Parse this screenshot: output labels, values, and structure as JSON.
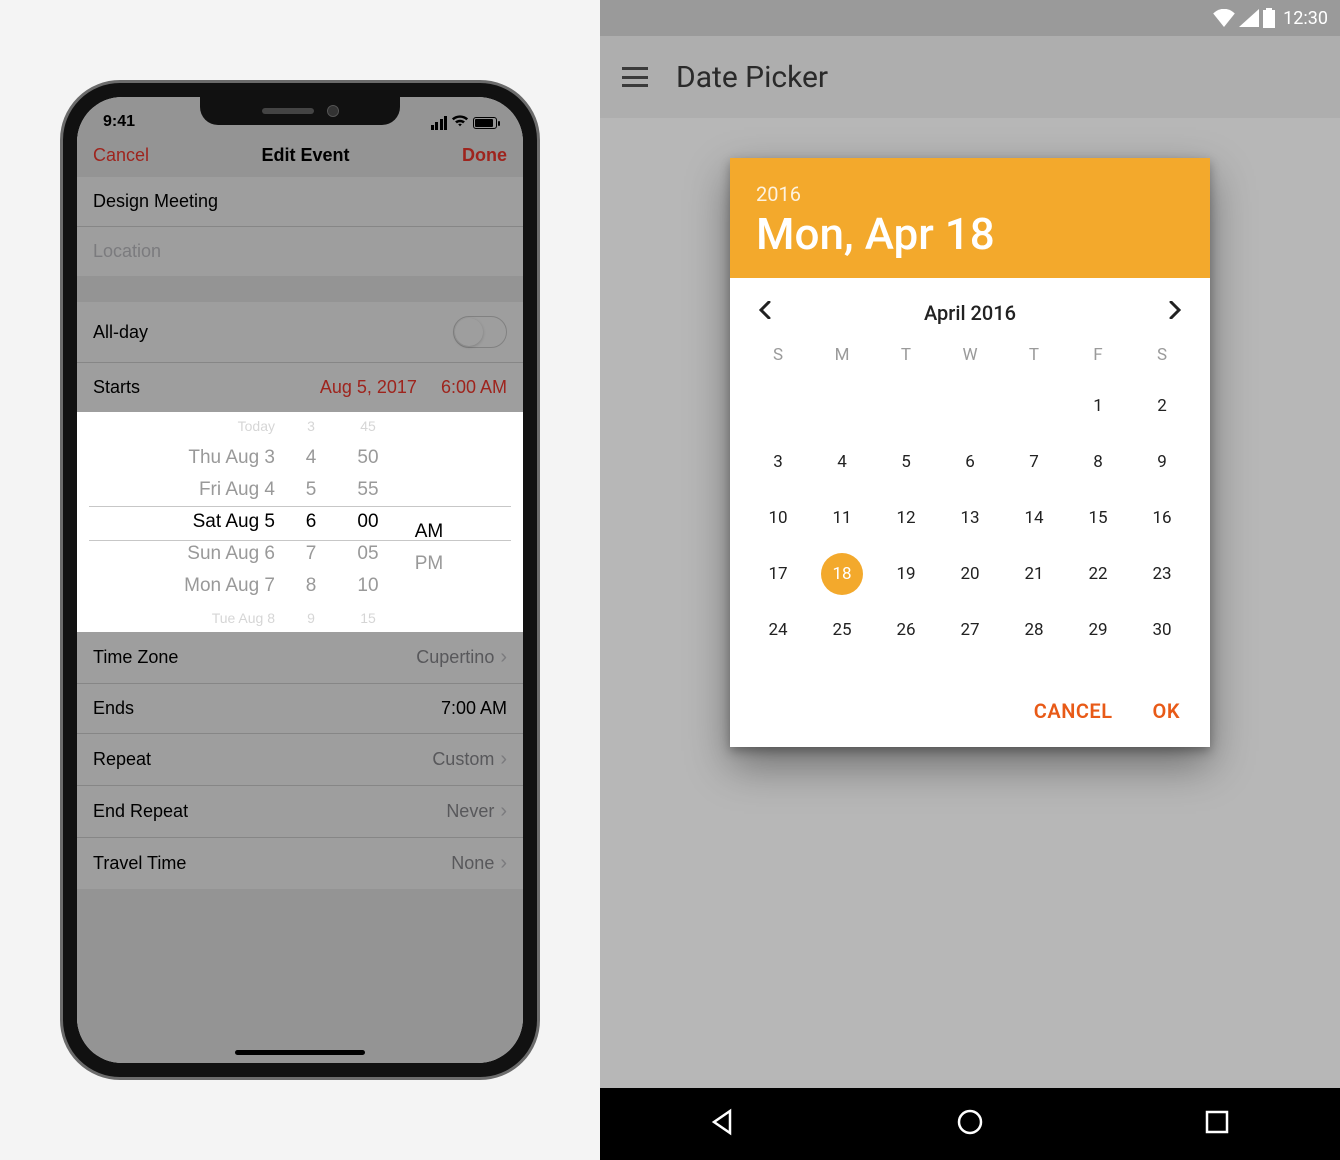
{
  "ios": {
    "status": {
      "time": "9:41"
    },
    "nav": {
      "cancel": "Cancel",
      "title": "Edit Event",
      "done": "Done"
    },
    "eventTitle": "Design Meeting",
    "locationPlaceholder": "Location",
    "allDayLabel": "All-day",
    "starts": {
      "label": "Starts",
      "date": "Aug 5, 2017",
      "time": "6:00 AM"
    },
    "picker": {
      "dates": [
        "",
        "Today",
        "Thu Aug 3",
        "Fri Aug 4",
        "Sat Aug 5",
        "Sun Aug 6",
        "Mon Aug 7",
        "Tue Aug 8"
      ],
      "hours": [
        "",
        "3",
        "4",
        "5",
        "6",
        "7",
        "8",
        "9"
      ],
      "minutes": [
        "",
        "45",
        "50",
        "55",
        "00",
        "05",
        "10",
        "15"
      ],
      "period": [
        "",
        "",
        "",
        "",
        "AM",
        "PM",
        "",
        ""
      ]
    },
    "timeZone": {
      "label": "Time Zone",
      "value": "Cupertino"
    },
    "ends": {
      "label": "Ends",
      "value": "7:00 AM"
    },
    "repeat": {
      "label": "Repeat",
      "value": "Custom"
    },
    "endRepeat": {
      "label": "End Repeat",
      "value": "Never"
    },
    "travelTime": {
      "label": "Travel Time",
      "value": "None"
    }
  },
  "android": {
    "status": {
      "time": "12:30"
    },
    "appbar": {
      "title": "Date Picker"
    },
    "dialog": {
      "year": "2016",
      "dateText": "Mon, Apr 18",
      "monthLabel": "April 2016",
      "dayHeaders": [
        "S",
        "M",
        "T",
        "W",
        "T",
        "F",
        "S"
      ],
      "leadingBlanks": 5,
      "daysInMonth": 30,
      "selectedDay": 18,
      "cancel": "CANCEL",
      "ok": "OK"
    }
  },
  "colors": {
    "accentOrange": "#f3a92c",
    "actionOrange": "#e85a17",
    "iosRed": "#ff3b30"
  }
}
